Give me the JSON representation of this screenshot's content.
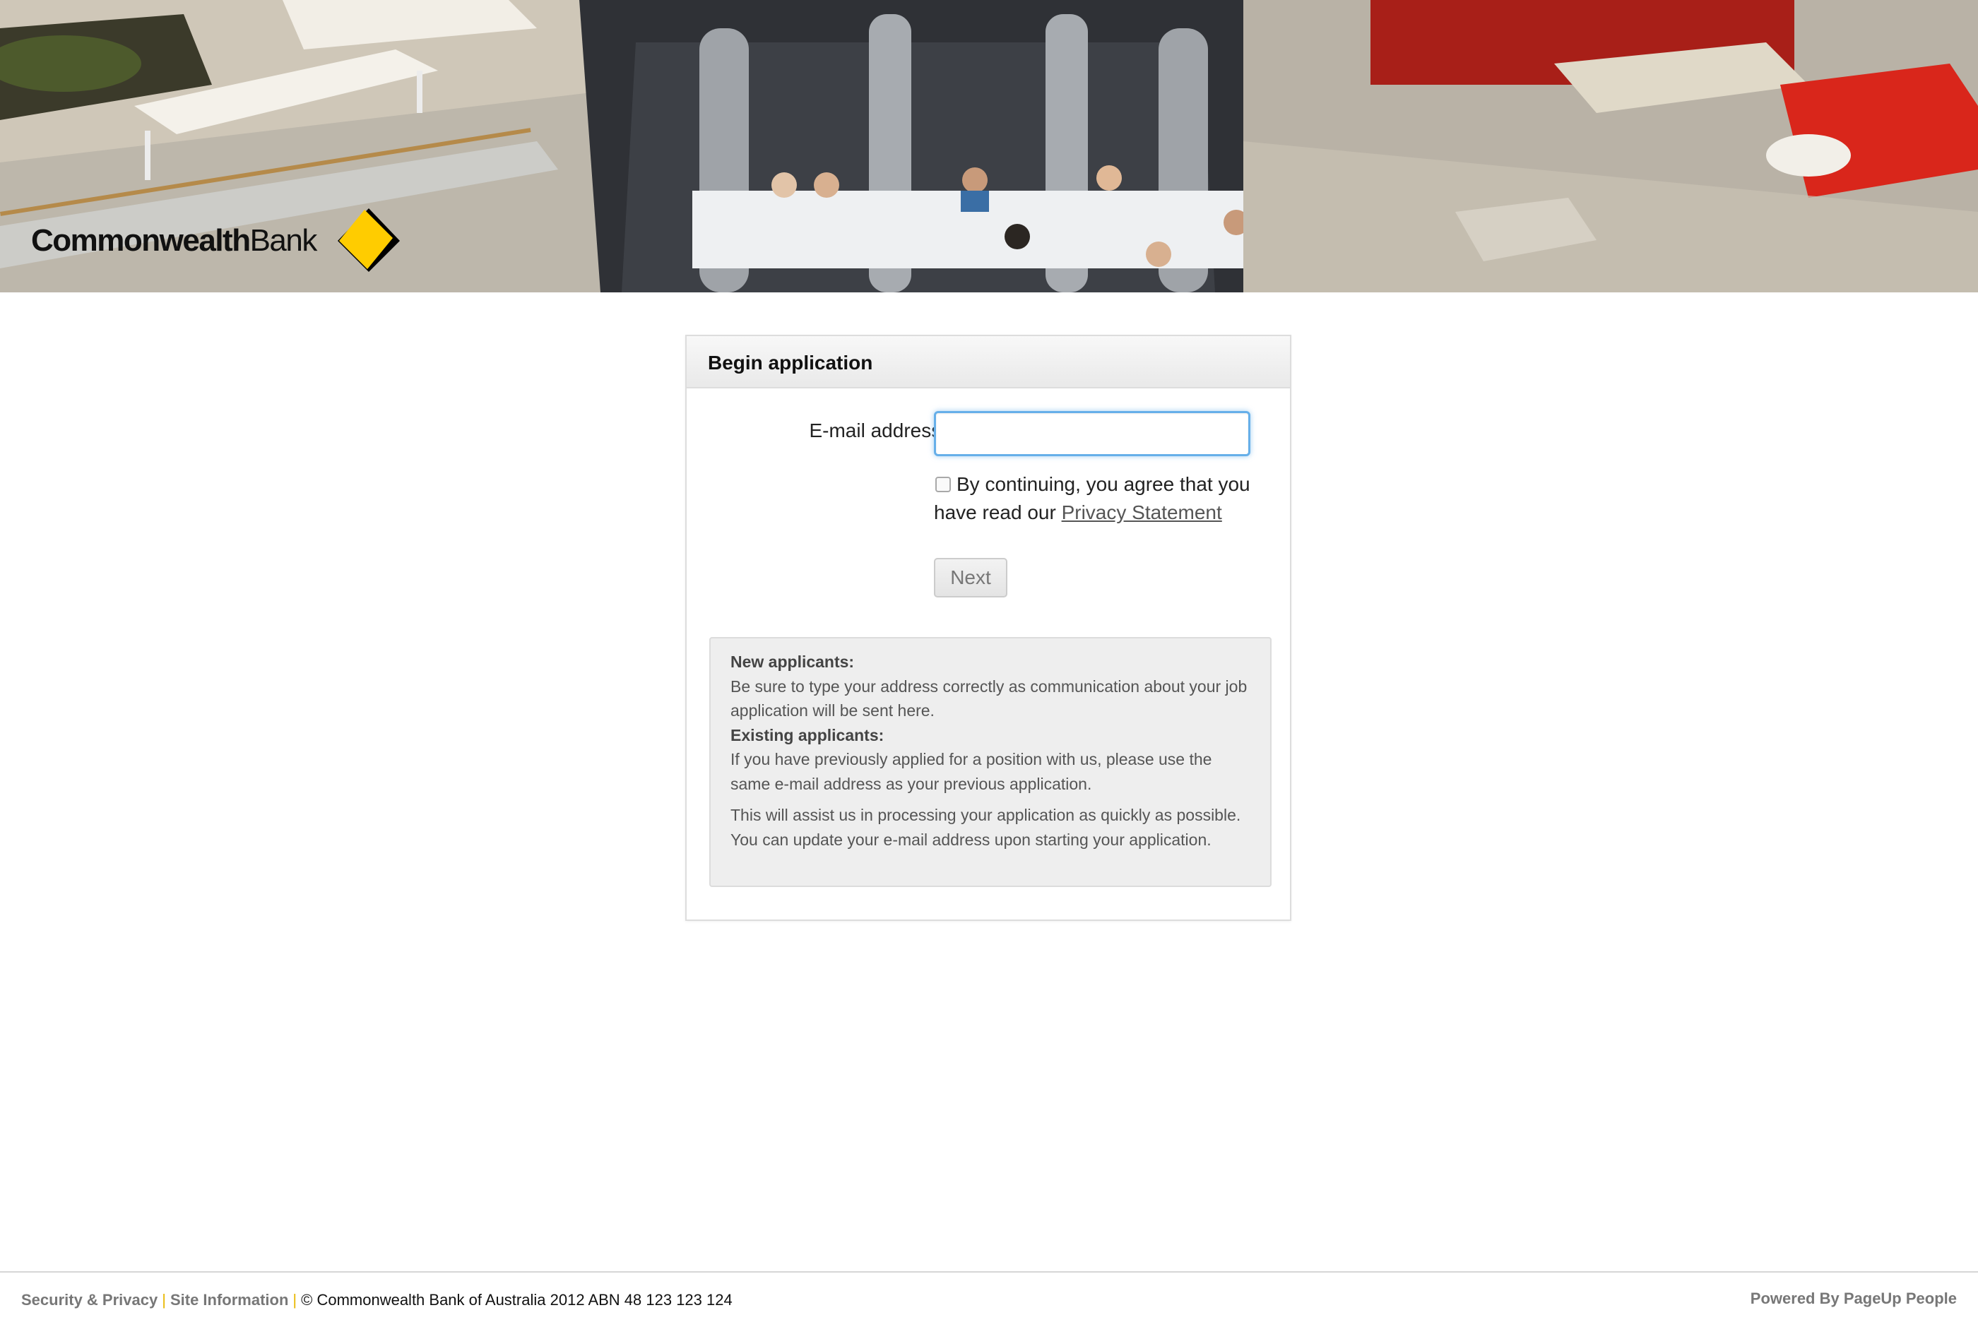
{
  "banner": {
    "logo": {
      "text_bold": "Commonwealth",
      "text_light": "Bank",
      "mark_colors": {
        "yellow": "#FFCC00",
        "black": "#000000"
      }
    }
  },
  "form": {
    "title": "Begin application",
    "email_label": "E-mail address:",
    "email_value": "",
    "email_placeholder": "",
    "agree_checked": false,
    "agree_text": "By continuing, you agree that you have read our",
    "privacy_link": "Privacy Statement",
    "next_label": "Next"
  },
  "info": {
    "new_heading": "New applicants:",
    "new_text": "Be sure to type your address correctly as communication about your job application will be sent here.",
    "existing_heading": "Existing applicants:",
    "existing_text": "If you have previously applied for a position with us, please use the same e-mail address as your previous application.",
    "assist_text": "This will assist us in processing your application as quickly as possible. You can update your e-mail address upon starting your application."
  },
  "footer": {
    "security_link": "Security & Privacy",
    "separator": "|",
    "site_info_link": "Site Information",
    "copyright": "© Commonwealth Bank of Australia 2012 ABN 48 123 123 124",
    "powered_by": "Powered By PageUp People"
  },
  "colors": {
    "accent_focus": "#66afe9",
    "footer_separator": "#e8b700",
    "brand_yellow": "#FFCC00"
  }
}
